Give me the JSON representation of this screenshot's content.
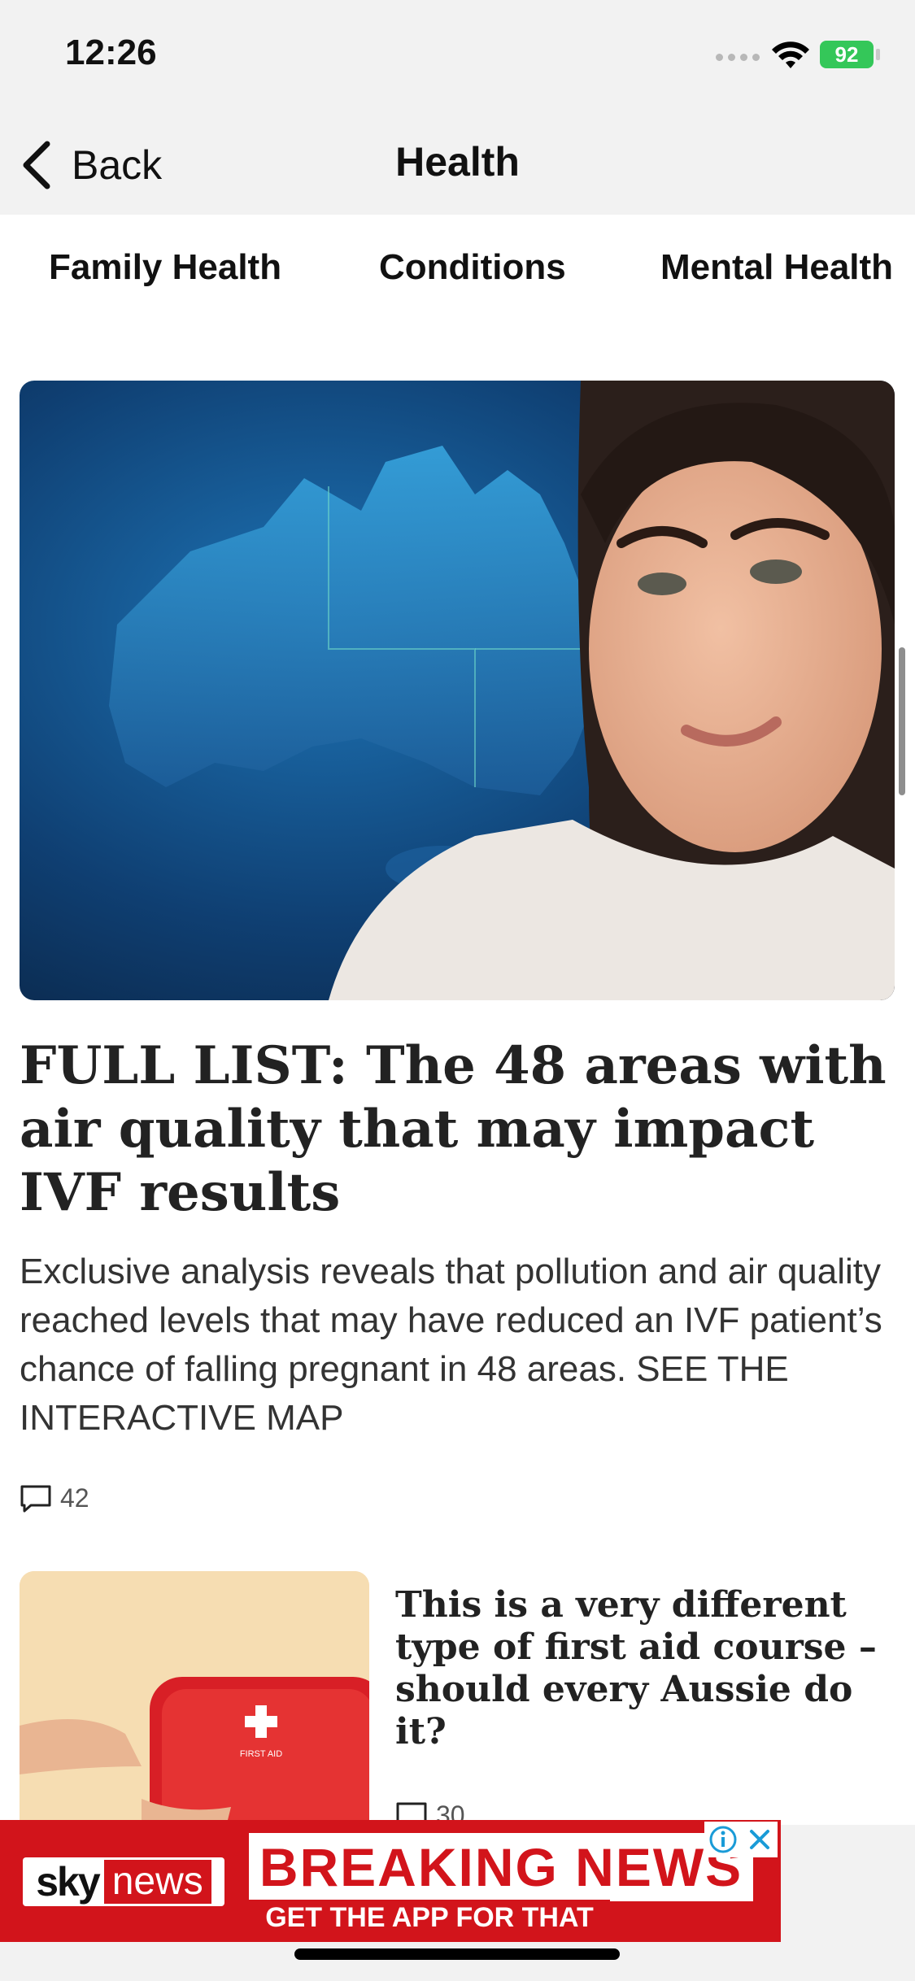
{
  "status_bar": {
    "time": "12:26",
    "battery": "92"
  },
  "nav": {
    "back_label": "Back",
    "title": "Health"
  },
  "tabs": [
    {
      "label": "Family Health"
    },
    {
      "label": "Conditions"
    },
    {
      "label": "Mental Health"
    }
  ],
  "feature": {
    "headline": "FULL LIST: The 48 areas with air quality that may impact IVF results",
    "summary": "Exclusive analysis reveals that pollution and air quality reached levels that may have reduced an IVF patient’s chance of falling pregnant in 48 areas. SEE THE INTERACTIVE MAP",
    "comment_count": "42"
  },
  "story2": {
    "headline": "This is a very different type of first aid course – should every Aussie do it?",
    "thumb_text": "FIRST AID",
    "comment_count": "30"
  },
  "ad": {
    "logo_sky": "sky",
    "logo_news": "news",
    "headline": "BREAKING NEWS",
    "subline": "GET THE APP FOR THAT"
  },
  "colors": {
    "brand_red": "#d2141b",
    "battery_green": "#34c759"
  }
}
